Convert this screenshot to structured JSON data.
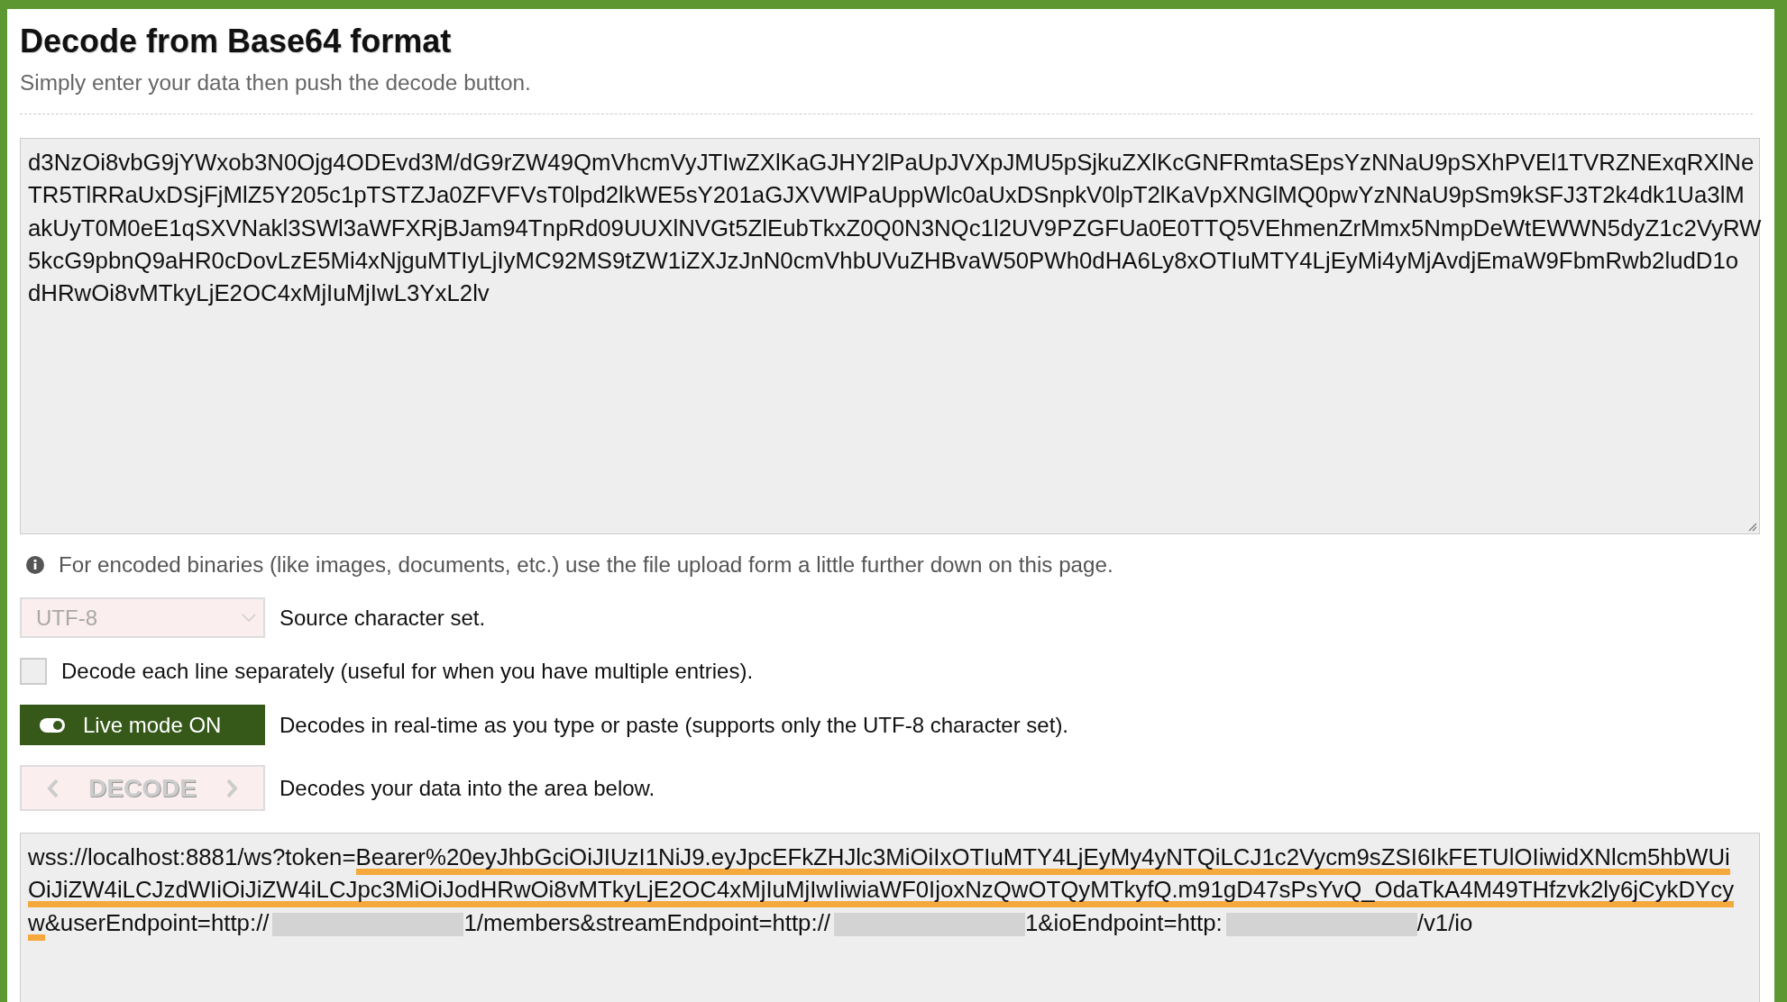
{
  "header": {
    "title": "Decode from Base64 format",
    "subtitle": "Simply enter your data then push the decode button."
  },
  "input": {
    "lines": [
      "d3NzOi8vbG9jYWxob3N0Ojg4ODEvd3M/dG9rZW49QmVhcmVyJTIwZXlKaGJHY2lPaUpJVXpJMU5pSjkuZXlKcGNFRmtaSEpsYzNNaU9pSXhPVEl1TVRZNExqRXlNe",
      "TR5TlRRaUxDSjFjMlZ5Y205c1pTSTZJa0ZFVFVsT0lpd2lkWE5sY201aGJXVWlPaUppWlc0aUxDSnpkV0lpT2lKaVpXNGlMQ0pwYzNNaU9pSm9kSFJ3T2k4dk1Ua3lM",
      "akUyT0M0eE1qSXVNakl3SWl3aWFXRjBJam94TnpRd09UUXlNVGt5ZlEubTkxZ0Q0N3NQc1l2UV9PZGFUa0E0TTQ5VEhmenZrMmx5NmpDeWtEWWN5dyZ1c2VyRW",
      "5kcG9pbnQ9aHR0cDovLzE5Mi4xNjguMTIyLjIyMC92MS9tZW1iZXJzJnN0cmVhbUVuZHBvaW50PWh0dHA6Ly8xOTIuMTY4LjEyMi4yMjAvdjEmaW9FbmRwb2ludD1o",
      "dHRwOi8vMTkyLjE2OC4xMjIuMjIwL3YxL2lv"
    ]
  },
  "info": "For encoded binaries (like images, documents, etc.) use the file upload form a little further down on this page.",
  "charset": {
    "value": "UTF-8",
    "disabled": true,
    "label": "Source character set."
  },
  "line_option": {
    "checked": false,
    "label": "Decode each line separately (useful for when you have multiple entries)."
  },
  "live_mode": {
    "on": true,
    "label": "Live mode ON",
    "description": "Decodes in real-time as you type or paste (supports only the UTF-8 character set)."
  },
  "decode": {
    "label": "DECODE",
    "disabled": true,
    "description": "Decodes your data into the area below."
  },
  "output": {
    "lines": [
      [
        {
          "kind": "text",
          "text": "wss://localhost:8881/ws?token="
        },
        {
          "kind": "highlight",
          "text": "Bearer%20eyJhbGciOiJIUzI1NiJ9.eyJpcEFkZHJlc3MiOiIxOTIuMTY4LjEyMy4yNTQiLCJ1c2Vycm9sZSI6IkFETUlOIiwidXNlcm5hbWUi"
        }
      ],
      [
        {
          "kind": "highlight",
          "text": "OiJiZW4iLCJzdWIiOiJiZW4iLCJpc3MiOiJodHRwOi8vMTkyLjE2OC4xMjIuMjIwIiwiaWF0IjoxNzQwOTQyMTkyfQ.m91gD47sPsYvQ_OdaTkA4M49THfzvk2ly6jCykDYcy"
        }
      ],
      [
        {
          "kind": "highlight",
          "text": "w"
        },
        {
          "kind": "text",
          "text": "&userEndpoint=http://"
        },
        {
          "kind": "redacted"
        },
        {
          "kind": "text",
          "text": "1/members&streamEndpoint=http://"
        },
        {
          "kind": "redacted"
        },
        {
          "kind": "text",
          "text": "1&ioEndpoint=http:"
        },
        {
          "kind": "redacted"
        },
        {
          "kind": "text",
          "text": "/v1/io"
        }
      ]
    ]
  }
}
